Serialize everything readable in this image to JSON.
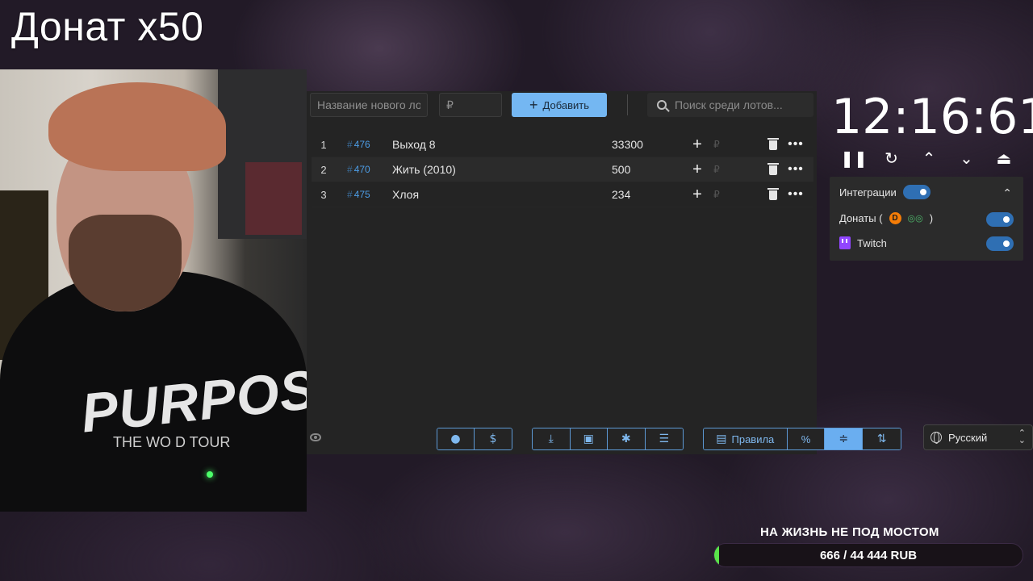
{
  "stream": {
    "title": "Донат х50"
  },
  "toolbar": {
    "lot_name_placeholder": "Название нового лота",
    "price_placeholder": "₽",
    "add_label": "Добавить",
    "search_placeholder": "Поиск среди лотов..."
  },
  "lots": [
    {
      "index": "1",
      "id": "476",
      "name": "Выход 8",
      "amount": "33300",
      "currency": "₽"
    },
    {
      "index": "2",
      "id": "470",
      "name": "Жить (2010)",
      "amount": "500",
      "currency": "₽"
    },
    {
      "index": "3",
      "id": "475",
      "name": "Хлоя",
      "amount": "234",
      "currency": "₽"
    }
  ],
  "footer": {
    "rules_label": "Правила",
    "percent_label": "%",
    "language": "Русский"
  },
  "timer": {
    "value": "12:16:61"
  },
  "integrations": {
    "title": "Интеграции",
    "donations_label": "Донаты (",
    "donations_suffix": ")",
    "twitch_label": "Twitch",
    "donations_icons": [
      "donationalerts-icon",
      "donatepay-icon"
    ]
  },
  "goal": {
    "title": "НА ЖИЗНЬ НЕ ПОД МОСТОМ",
    "text": "666 / 44 444 RUB",
    "progress": 0.015
  },
  "webcam": {
    "shirt_text": "PURPOSE",
    "shirt_sub": "THE WO   D TOUR"
  },
  "colors": {
    "accent": "#74b7f2",
    "twitch": "#9146ff",
    "goal_fill": "#59e34a"
  }
}
